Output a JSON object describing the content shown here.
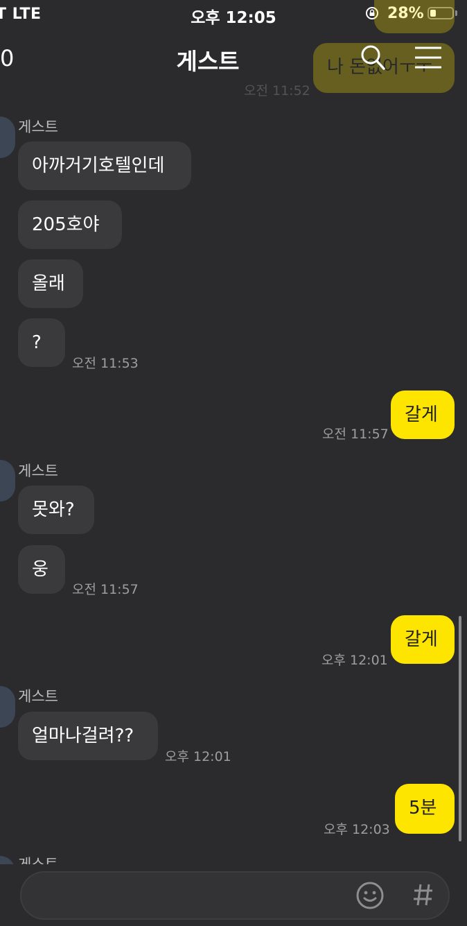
{
  "status": {
    "carrier": "T  LTE",
    "time": "오후 12:05",
    "battery": "28%",
    "battery_level": 0.28
  },
  "header": {
    "back_count": "0",
    "title": "게스트"
  },
  "ghost": {
    "message": "나 돈없어ㅜㅜ",
    "time": "오전 11:52"
  },
  "groups": [
    {
      "name": "게스트",
      "messages": [
        "아까거기호텔인데",
        "205호야",
        "올래",
        "?"
      ],
      "time": "오전 11:53"
    },
    {
      "name": "게스트",
      "messages": [
        "못와?",
        "웅"
      ],
      "time": "오전 11:57"
    },
    {
      "name": "게스트",
      "messages": [
        "얼마나걸려??"
      ],
      "time": "오후 12:01"
    }
  ],
  "outgoing": [
    {
      "text": "갈게",
      "time": "오전 11:57"
    },
    {
      "text": "갈게",
      "time": "오후 12:01"
    },
    {
      "text": "5분",
      "time": "오후 12:03"
    }
  ],
  "partial_name": "게스트",
  "icons": [
    "search-icon",
    "menu-icon",
    "emoji-icon",
    "hash-icon",
    "lock-rotation-icon"
  ],
  "colors": {
    "background": "#2b2b2d",
    "incoming": "#3a3a3d",
    "outgoing": "#fee500"
  }
}
